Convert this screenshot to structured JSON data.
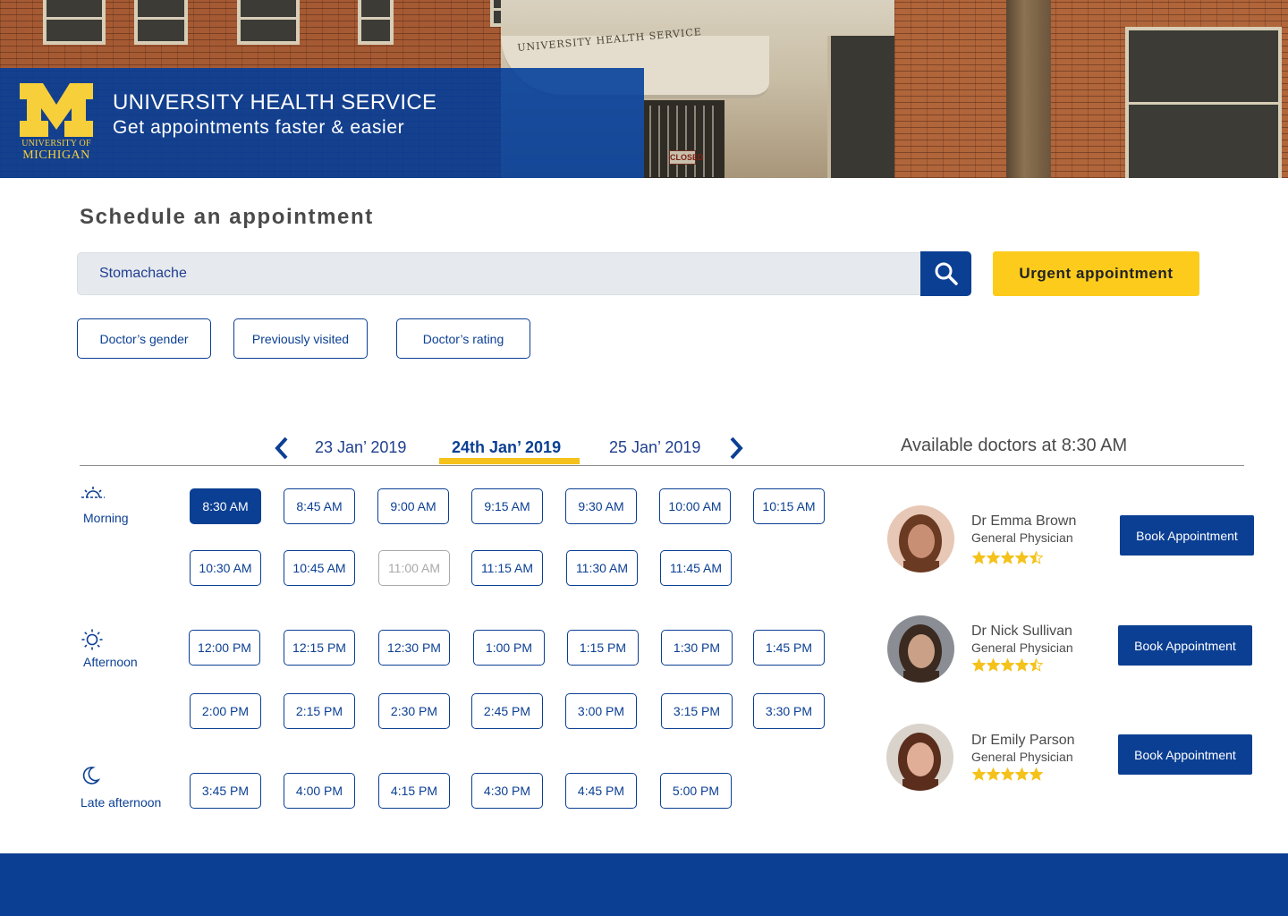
{
  "brand": {
    "logo_line1": "UNIVERSITY OF",
    "logo_line2": "MICHIGAN",
    "title": "UNIVERSITY HEALTH SERVICE",
    "subtitle": "Get appointments faster & easier",
    "building_sign": "UNIVERSITY HEALTH SERVICE",
    "door_sign": "CLOSED"
  },
  "page_title": "Schedule an appointment",
  "search": {
    "value": "Stomachache",
    "placeholder": "",
    "icon": "search-icon"
  },
  "urgent_label": "Urgent appointment",
  "filters": [
    "Doctor’s gender",
    "Previously visited",
    "Doctor’s rating"
  ],
  "dates": {
    "prev": "23 Jan’ 2019",
    "current": "24th  Jan’ 2019",
    "next": "25 Jan’ 2019"
  },
  "periods": {
    "morning": "Morning",
    "afternoon": "Afternoon",
    "late": "Late afternoon"
  },
  "slots": {
    "morning_row1": [
      "8:30 AM",
      "8:45 AM",
      "9:00 AM",
      "9:15 AM",
      "9:30 AM",
      "10:00 AM",
      "10:15 AM"
    ],
    "morning_row2": [
      "10:30 AM",
      "10:45 AM",
      "11:00 AM",
      "11:15 AM",
      "11:30 AM",
      "11:45 AM"
    ],
    "afternoon_row1": [
      "12:00 PM",
      "12:15 PM",
      "12:30 PM",
      "1:00 PM",
      "1:15 PM",
      "1:30 PM",
      "1:45 PM"
    ],
    "afternoon_row2": [
      "2:00 PM",
      "2:15 PM",
      "2:30 PM",
      "2:45 PM",
      "3:00 PM",
      "3:15 PM",
      "3:30 PM"
    ],
    "late_row1": [
      "3:45 PM",
      "4:00 PM",
      "4:15 PM",
      "4:30 PM",
      "4:45 PM",
      "5:00 PM"
    ],
    "selected": "8:30 AM",
    "unavailable": "11:00 AM"
  },
  "available_title": "Available doctors at 8:30 AM",
  "doctors": [
    {
      "name": "Dr Emma Brown",
      "role": "General Physician",
      "rating": 4.5,
      "book": "Book Appointment"
    },
    {
      "name": "Dr Nick Sullivan",
      "role": "General Physician",
      "rating": 4.5,
      "book": "Book Appointment"
    },
    {
      "name": "Dr Emily Parson",
      "role": "General Physician",
      "rating": 5,
      "book": "Book Appointment"
    }
  ],
  "colors": {
    "brand_blue": "#0b3f93",
    "maize": "#fccb1c",
    "star": "#f4c21b",
    "disabled": "#a9a9a9"
  }
}
